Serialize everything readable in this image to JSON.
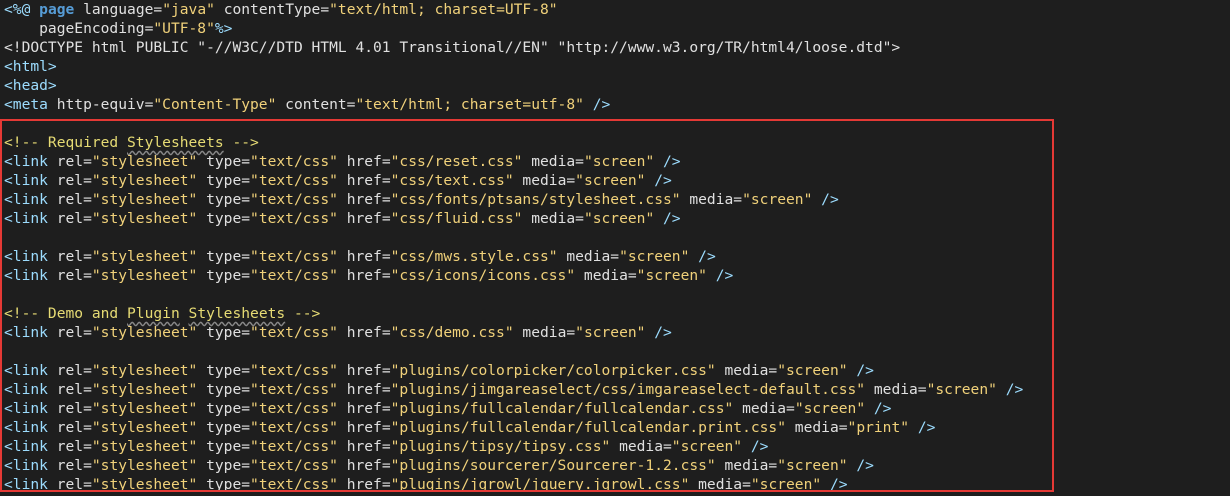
{
  "editor": {
    "annotation_color": "#e53935",
    "lines": [
      [
        {
          "t": "<%@ ",
          "c": "tag"
        },
        {
          "t": "page",
          "c": "kw"
        },
        {
          "t": " language=",
          "c": "attr"
        },
        {
          "t": "\"java\"",
          "c": "str"
        },
        {
          "t": " contentType=",
          "c": "attr"
        },
        {
          "t": "\"text/html; charset=UTF-8\"",
          "c": "str"
        }
      ],
      [
        {
          "t": "    pageEncoding=",
          "c": "attr"
        },
        {
          "t": "\"UTF-8\"",
          "c": "str"
        },
        {
          "t": "%>",
          "c": "tag"
        }
      ],
      [
        {
          "t": "<!DOCTYPE html PUBLIC \"-//W3C//DTD HTML 4.01 Transitional//EN\" \"http://www.w3.org/TR/html4/loose.dtd\">",
          "c": "text"
        }
      ],
      [
        {
          "t": "<html>",
          "c": "tag"
        }
      ],
      [
        {
          "t": "<head>",
          "c": "tag"
        }
      ],
      [
        {
          "t": "<meta ",
          "c": "tag"
        },
        {
          "t": "http-equiv=",
          "c": "attr"
        },
        {
          "t": "\"Content-Type\"",
          "c": "str"
        },
        {
          "t": " content=",
          "c": "attr"
        },
        {
          "t": "\"text/html; charset=utf-8\"",
          "c": "str"
        },
        {
          "t": " />",
          "c": "tag"
        }
      ],
      [],
      [
        {
          "t": "<!-- Required ",
          "c": "comment"
        },
        {
          "t": "Stylesheets",
          "c": "comment spell"
        },
        {
          "t": " -->",
          "c": "comment"
        }
      ],
      [
        {
          "t": "<link ",
          "c": "tag"
        },
        {
          "t": "rel=",
          "c": "attr"
        },
        {
          "t": "\"stylesheet\"",
          "c": "str"
        },
        {
          "t": " type=",
          "c": "attr"
        },
        {
          "t": "\"text/css\"",
          "c": "str"
        },
        {
          "t": " href=",
          "c": "attr"
        },
        {
          "t": "\"css/reset.css\"",
          "c": "str"
        },
        {
          "t": " media=",
          "c": "attr"
        },
        {
          "t": "\"screen\"",
          "c": "str"
        },
        {
          "t": " />",
          "c": "tag"
        }
      ],
      [
        {
          "t": "<link ",
          "c": "tag"
        },
        {
          "t": "rel=",
          "c": "attr"
        },
        {
          "t": "\"stylesheet\"",
          "c": "str"
        },
        {
          "t": " type=",
          "c": "attr"
        },
        {
          "t": "\"text/css\"",
          "c": "str"
        },
        {
          "t": " href=",
          "c": "attr"
        },
        {
          "t": "\"css/text.css\"",
          "c": "str"
        },
        {
          "t": " media=",
          "c": "attr"
        },
        {
          "t": "\"screen\"",
          "c": "str"
        },
        {
          "t": " />",
          "c": "tag"
        }
      ],
      [
        {
          "t": "<link ",
          "c": "tag"
        },
        {
          "t": "rel=",
          "c": "attr"
        },
        {
          "t": "\"stylesheet\"",
          "c": "str"
        },
        {
          "t": " type=",
          "c": "attr"
        },
        {
          "t": "\"text/css\"",
          "c": "str"
        },
        {
          "t": " href=",
          "c": "attr"
        },
        {
          "t": "\"css/fonts/ptsans/stylesheet.css\"",
          "c": "str"
        },
        {
          "t": " media=",
          "c": "attr"
        },
        {
          "t": "\"screen\"",
          "c": "str"
        },
        {
          "t": " />",
          "c": "tag"
        }
      ],
      [
        {
          "t": "<link ",
          "c": "tag"
        },
        {
          "t": "rel=",
          "c": "attr"
        },
        {
          "t": "\"stylesheet\"",
          "c": "str"
        },
        {
          "t": " type=",
          "c": "attr"
        },
        {
          "t": "\"text/css\"",
          "c": "str"
        },
        {
          "t": " href=",
          "c": "attr"
        },
        {
          "t": "\"css/fluid.css\"",
          "c": "str"
        },
        {
          "t": " media=",
          "c": "attr"
        },
        {
          "t": "\"screen\"",
          "c": "str"
        },
        {
          "t": " />",
          "c": "tag"
        }
      ],
      [],
      [
        {
          "t": "<link ",
          "c": "tag"
        },
        {
          "t": "rel=",
          "c": "attr"
        },
        {
          "t": "\"stylesheet\"",
          "c": "str"
        },
        {
          "t": " type=",
          "c": "attr"
        },
        {
          "t": "\"text/css\"",
          "c": "str"
        },
        {
          "t": " href=",
          "c": "attr"
        },
        {
          "t": "\"css/mws.style.css\"",
          "c": "str"
        },
        {
          "t": " media=",
          "c": "attr"
        },
        {
          "t": "\"screen\"",
          "c": "str"
        },
        {
          "t": " />",
          "c": "tag"
        }
      ],
      [
        {
          "t": "<link ",
          "c": "tag"
        },
        {
          "t": "rel=",
          "c": "attr"
        },
        {
          "t": "\"stylesheet\"",
          "c": "str"
        },
        {
          "t": " type=",
          "c": "attr"
        },
        {
          "t": "\"text/css\"",
          "c": "str"
        },
        {
          "t": " href=",
          "c": "attr"
        },
        {
          "t": "\"css/icons/icons.css\"",
          "c": "str"
        },
        {
          "t": " media=",
          "c": "attr"
        },
        {
          "t": "\"screen\"",
          "c": "str"
        },
        {
          "t": " />",
          "c": "tag"
        }
      ],
      [],
      [
        {
          "t": "<!-- Demo and ",
          "c": "comment"
        },
        {
          "t": "Plugin",
          "c": "comment spell"
        },
        {
          "t": " ",
          "c": "comment"
        },
        {
          "t": "Stylesheets",
          "c": "comment spell"
        },
        {
          "t": " -->",
          "c": "comment"
        }
      ],
      [
        {
          "t": "<link ",
          "c": "tag"
        },
        {
          "t": "rel=",
          "c": "attr"
        },
        {
          "t": "\"stylesheet\"",
          "c": "str"
        },
        {
          "t": " type=",
          "c": "attr"
        },
        {
          "t": "\"text/css\"",
          "c": "str"
        },
        {
          "t": " href=",
          "c": "attr"
        },
        {
          "t": "\"css/demo.css\"",
          "c": "str"
        },
        {
          "t": " media=",
          "c": "attr"
        },
        {
          "t": "\"screen\"",
          "c": "str"
        },
        {
          "t": " />",
          "c": "tag"
        }
      ],
      [],
      [
        {
          "t": "<link ",
          "c": "tag"
        },
        {
          "t": "rel=",
          "c": "attr"
        },
        {
          "t": "\"stylesheet\"",
          "c": "str"
        },
        {
          "t": " type=",
          "c": "attr"
        },
        {
          "t": "\"text/css\"",
          "c": "str"
        },
        {
          "t": " href=",
          "c": "attr"
        },
        {
          "t": "\"plugins/colorpicker/colorpicker.css\"",
          "c": "str"
        },
        {
          "t": " media=",
          "c": "attr"
        },
        {
          "t": "\"screen\"",
          "c": "str"
        },
        {
          "t": " />",
          "c": "tag"
        }
      ],
      [
        {
          "t": "<link ",
          "c": "tag"
        },
        {
          "t": "rel=",
          "c": "attr"
        },
        {
          "t": "\"stylesheet\"",
          "c": "str"
        },
        {
          "t": " type=",
          "c": "attr"
        },
        {
          "t": "\"text/css\"",
          "c": "str"
        },
        {
          "t": " href=",
          "c": "attr"
        },
        {
          "t": "\"plugins/jimgareaselect/css/imgareaselect-default.css\"",
          "c": "str"
        },
        {
          "t": " media=",
          "c": "attr"
        },
        {
          "t": "\"screen\"",
          "c": "str"
        },
        {
          "t": " />",
          "c": "tag"
        }
      ],
      [
        {
          "t": "<link ",
          "c": "tag"
        },
        {
          "t": "rel=",
          "c": "attr"
        },
        {
          "t": "\"stylesheet\"",
          "c": "str"
        },
        {
          "t": " type=",
          "c": "attr"
        },
        {
          "t": "\"text/css\"",
          "c": "str"
        },
        {
          "t": " href=",
          "c": "attr"
        },
        {
          "t": "\"plugins/fullcalendar/fullcalendar.css\"",
          "c": "str"
        },
        {
          "t": " media=",
          "c": "attr"
        },
        {
          "t": "\"screen\"",
          "c": "str"
        },
        {
          "t": " />",
          "c": "tag"
        }
      ],
      [
        {
          "t": "<link ",
          "c": "tag"
        },
        {
          "t": "rel=",
          "c": "attr"
        },
        {
          "t": "\"stylesheet\"",
          "c": "str"
        },
        {
          "t": " type=",
          "c": "attr"
        },
        {
          "t": "\"text/css\"",
          "c": "str"
        },
        {
          "t": " href=",
          "c": "attr"
        },
        {
          "t": "\"plugins/fullcalendar/fullcalendar.print.css\"",
          "c": "str"
        },
        {
          "t": " media=",
          "c": "attr"
        },
        {
          "t": "\"print\"",
          "c": "str"
        },
        {
          "t": " />",
          "c": "tag"
        }
      ],
      [
        {
          "t": "<link ",
          "c": "tag"
        },
        {
          "t": "rel=",
          "c": "attr"
        },
        {
          "t": "\"stylesheet\"",
          "c": "str"
        },
        {
          "t": " type=",
          "c": "attr"
        },
        {
          "t": "\"text/css\"",
          "c": "str"
        },
        {
          "t": " href=",
          "c": "attr"
        },
        {
          "t": "\"plugins/tipsy/tipsy.css\"",
          "c": "str"
        },
        {
          "t": " media=",
          "c": "attr"
        },
        {
          "t": "\"screen\"",
          "c": "str"
        },
        {
          "t": " />",
          "c": "tag"
        }
      ],
      [
        {
          "t": "<link ",
          "c": "tag"
        },
        {
          "t": "rel=",
          "c": "attr"
        },
        {
          "t": "\"stylesheet\"",
          "c": "str"
        },
        {
          "t": " type=",
          "c": "attr"
        },
        {
          "t": "\"text/css\"",
          "c": "str"
        },
        {
          "t": " href=",
          "c": "attr"
        },
        {
          "t": "\"plugins/sourcerer/Sourcerer-1.2.css\"",
          "c": "str"
        },
        {
          "t": " media=",
          "c": "attr"
        },
        {
          "t": "\"screen\"",
          "c": "str"
        },
        {
          "t": " />",
          "c": "tag"
        }
      ],
      [
        {
          "t": "<link ",
          "c": "tag"
        },
        {
          "t": "rel=",
          "c": "attr"
        },
        {
          "t": "\"stylesheet\"",
          "c": "str"
        },
        {
          "t": " type=",
          "c": "attr"
        },
        {
          "t": "\"text/css\"",
          "c": "str"
        },
        {
          "t": " href=",
          "c": "attr"
        },
        {
          "t": "\"plugins/jgrowl/jquery.jgrowl.css\"",
          "c": "str"
        },
        {
          "t": " media=",
          "c": "attr"
        },
        {
          "t": "\"screen\"",
          "c": "str"
        },
        {
          "t": " />",
          "c": "tag"
        }
      ]
    ]
  }
}
